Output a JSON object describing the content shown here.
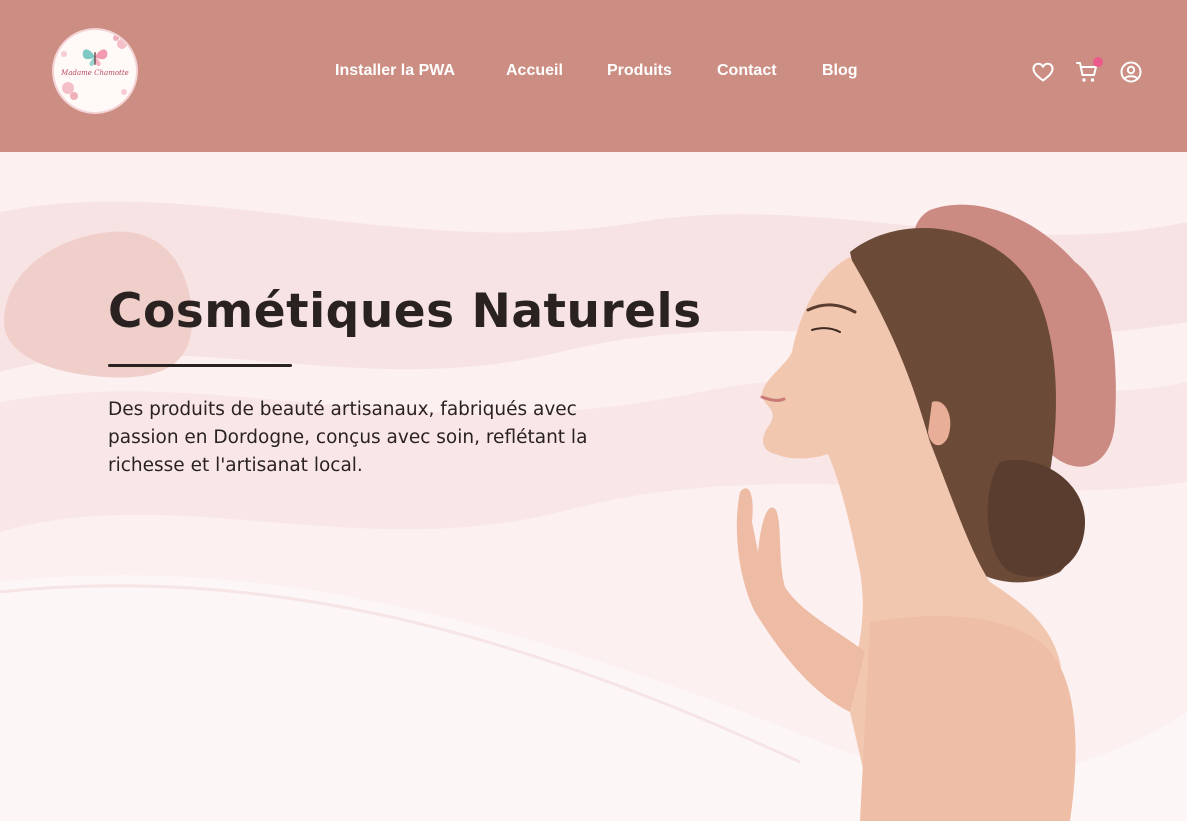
{
  "header": {
    "logo_text": "Madame Chamotte",
    "nav": [
      {
        "label": "Installer la PWA"
      },
      {
        "label": "Accueil"
      },
      {
        "label": "Produits"
      },
      {
        "label": "Contact"
      },
      {
        "label": "Blog"
      }
    ],
    "icons": [
      "heart-icon",
      "cart-icon",
      "user-icon"
    ],
    "cart_badge_color": "#ec5a8c"
  },
  "hero": {
    "title": "Cosmétiques Naturels",
    "description": "Des produits de beauté artisanaux, fabriqués avec passion en Dordogne, conçus avec soin, reflétant la richesse et l'artisanat local."
  },
  "colors": {
    "header_bg": "#cc8d82",
    "hero_bg": "#fcf0f0",
    "text": "#2a2221",
    "blob": "#cb8a82"
  }
}
